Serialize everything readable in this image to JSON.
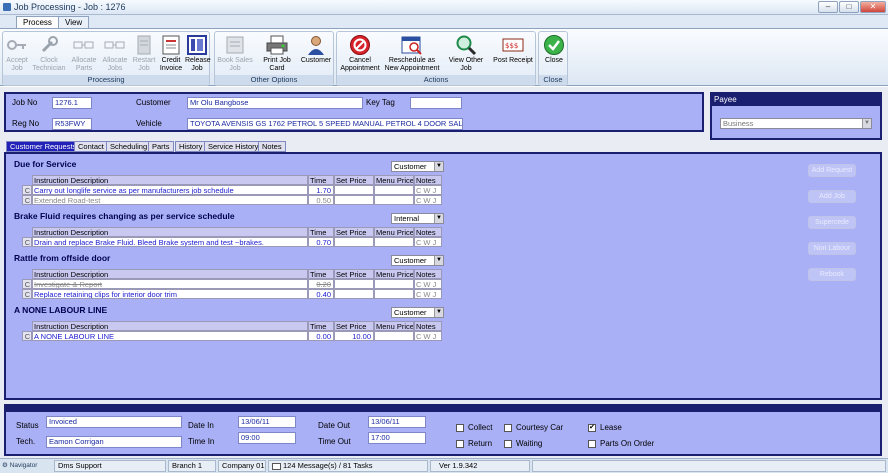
{
  "window": {
    "title": "Job Processing - Job : 1276"
  },
  "ribbon_tabs": [
    "Process",
    "View"
  ],
  "ribbon": {
    "groups": [
      {
        "label": "Processing",
        "buttons": [
          "Accept Job",
          "Clock Technician",
          "Allocate Parts",
          "Allocate Jobs",
          "Restart Job",
          "Credit Invoice",
          "Release Job"
        ]
      },
      {
        "label": "Other Options",
        "buttons": [
          "Book Sales Job",
          "Print Job Card",
          "Customer"
        ]
      },
      {
        "label": "Actions",
        "buttons": [
          "Cancel Appointment",
          "Reschedule as New Appointment",
          "View Other Job",
          "Post Receipt"
        ]
      },
      {
        "label": "Close",
        "buttons": [
          "Close"
        ]
      }
    ]
  },
  "header": {
    "job_no_label": "Job No",
    "job_no": "1276.1",
    "reg_no_label": "Reg No",
    "reg_no": "R53FWY",
    "customer_label": "Customer",
    "customer": "Mr Olu Bangbose",
    "vehicle_label": "Vehicle",
    "vehicle": "TOYOTA AVENSIS GS 1762 PETROL 5 SPEED MANUAL PETROL 4 DOOR SALOON",
    "key_tag_label": "Key Tag",
    "key_tag": ""
  },
  "payee": {
    "label": "Payee",
    "value": "Business"
  },
  "content_tabs": [
    "Customer Requests",
    "Contact",
    "Scheduling",
    "Parts",
    "History",
    "Service History",
    "Notes"
  ],
  "columns": {
    "desc": "Instruction Description",
    "time": "Time",
    "set_price": "Set Price",
    "menu_price": "Menu Price",
    "notes": "Notes"
  },
  "sections": [
    {
      "title": "Due for Service",
      "payer": "Customer",
      "rows": [
        {
          "flag": "C",
          "desc": "Carry out longlife service as per manufacturers job schedule",
          "time": "1.70",
          "set_price": "",
          "menu_price": "",
          "style": "blue"
        },
        {
          "flag": "C",
          "desc": "Extended Road-test",
          "time": "0.50",
          "set_price": "",
          "menu_price": "",
          "style": "grey"
        }
      ]
    },
    {
      "title": "Brake Fluid requires changing as per service schedule",
      "payer": "Internal",
      "rows": [
        {
          "flag": "C",
          "desc": "Drain and replace Brake Fluid. Bleed Brake system and test ~brakes.",
          "time": "0.70",
          "set_price": "",
          "menu_price": "",
          "style": "blue"
        }
      ]
    },
    {
      "title": "Rattle from offside door",
      "payer": "Customer",
      "rows": [
        {
          "flag": "C",
          "desc": "Investigate & Report",
          "time": "0.20",
          "set_price": "",
          "menu_price": "",
          "style": "strike"
        },
        {
          "flag": "C",
          "desc": "Replace retaining clips for interior door trim",
          "time": "0.40",
          "set_price": "",
          "menu_price": "",
          "style": "blue"
        }
      ]
    },
    {
      "title": "A NONE LABOUR LINE",
      "payer": "Customer",
      "rows": [
        {
          "flag": "C",
          "desc": "A NONE LABOUR LINE",
          "time": "0.00",
          "set_price": "10.00",
          "menu_price": "",
          "style": "blue"
        }
      ]
    }
  ],
  "notes_letters": [
    "C",
    "W",
    "J"
  ],
  "side_buttons": [
    "Add Request",
    "Add Job",
    "Supercede",
    "Non Labour",
    "Rebook"
  ],
  "footer": {
    "status_label": "Status",
    "status": "Invoiced",
    "tech_label": "Tech.",
    "tech": "Eamon Corrigan",
    "date_in_label": "Date In",
    "date_in": "13/06/11",
    "time_in_label": "Time In",
    "time_in": "09:00",
    "date_out_label": "Date Out",
    "date_out": "13/06/11",
    "time_out_label": "Time Out",
    "time_out": "17:00",
    "checks": [
      {
        "label": "Collect",
        "checked": false
      },
      {
        "label": "Courtesy Car",
        "checked": false
      },
      {
        "label": "Lease",
        "checked": true
      },
      {
        "label": "Return",
        "checked": false
      },
      {
        "label": "Waiting",
        "checked": false
      },
      {
        "label": "Parts On Order",
        "checked": false
      }
    ]
  },
  "statusbar": {
    "navigator": "Navigator",
    "user": "Dms Support",
    "branch": "Branch 1",
    "company": "Company 01",
    "messages": "124 Message(s) / 81 Tasks",
    "version": "Ver 1.9.342"
  },
  "colors": {
    "navy": "#1a1f70",
    "panel": "#a9b0f5",
    "link_blue": "#1a1ad0"
  }
}
